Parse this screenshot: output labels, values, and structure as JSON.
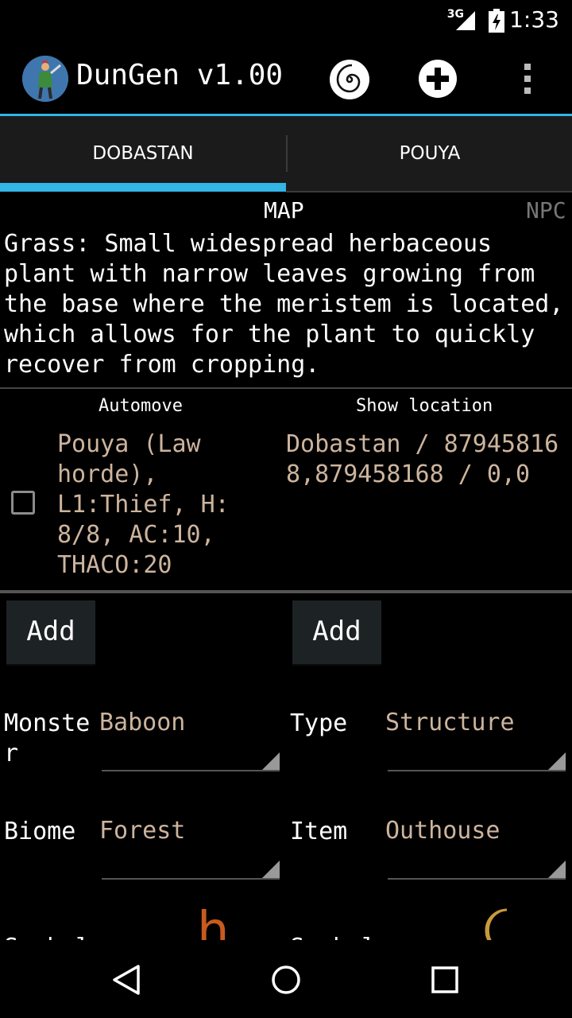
{
  "status_bar": {
    "network": "3G",
    "time": "1:33"
  },
  "app_bar": {
    "title": "DunGen v1.00"
  },
  "tabs": [
    {
      "label": "DOBASTAN",
      "selected": true
    },
    {
      "label": "POUYA",
      "selected": false
    }
  ],
  "sub_tabs": {
    "map": "MAP",
    "npc": "NPC"
  },
  "description": "Grass: Small widespread herbaceous plant with narrow leaves growing from the base where the meristem is located, which allows for the plant to quickly recover from cropping.",
  "table": {
    "headers": {
      "automove": "Automove",
      "show_location": "Show location"
    },
    "rows": [
      {
        "checked": false,
        "npc": "Pouya (Law horde), L1:Thief, H: 8/8, AC:10, THACO:20",
        "location": "Dobastan / 879458168,879458168 / 0,0"
      }
    ]
  },
  "buttons": {
    "add_left": "Add",
    "add_right": "Add"
  },
  "form": {
    "monster_label": "Monster",
    "monster_value": "Baboon",
    "type_label": "Type",
    "type_value": "Structure",
    "biome_label": "Biome",
    "biome_value": "Forest",
    "item_label": "Item",
    "item_value": "Outhouse",
    "symbol_label_left": "Symbol",
    "symbol_label_right": "Symbol",
    "symbol_left": "h"
  },
  "colors": {
    "accent": "#33b5e5",
    "value_text": "#cdb49d",
    "symbol_orange": "#c85a1e",
    "symbol_gold": "#c89a3c"
  },
  "icons": [
    "signal-icon",
    "battery-icon",
    "app-icon",
    "spiral-icon",
    "add-icon",
    "overflow-menu-icon",
    "back-icon",
    "home-icon",
    "recents-icon",
    "moon-icon"
  ]
}
